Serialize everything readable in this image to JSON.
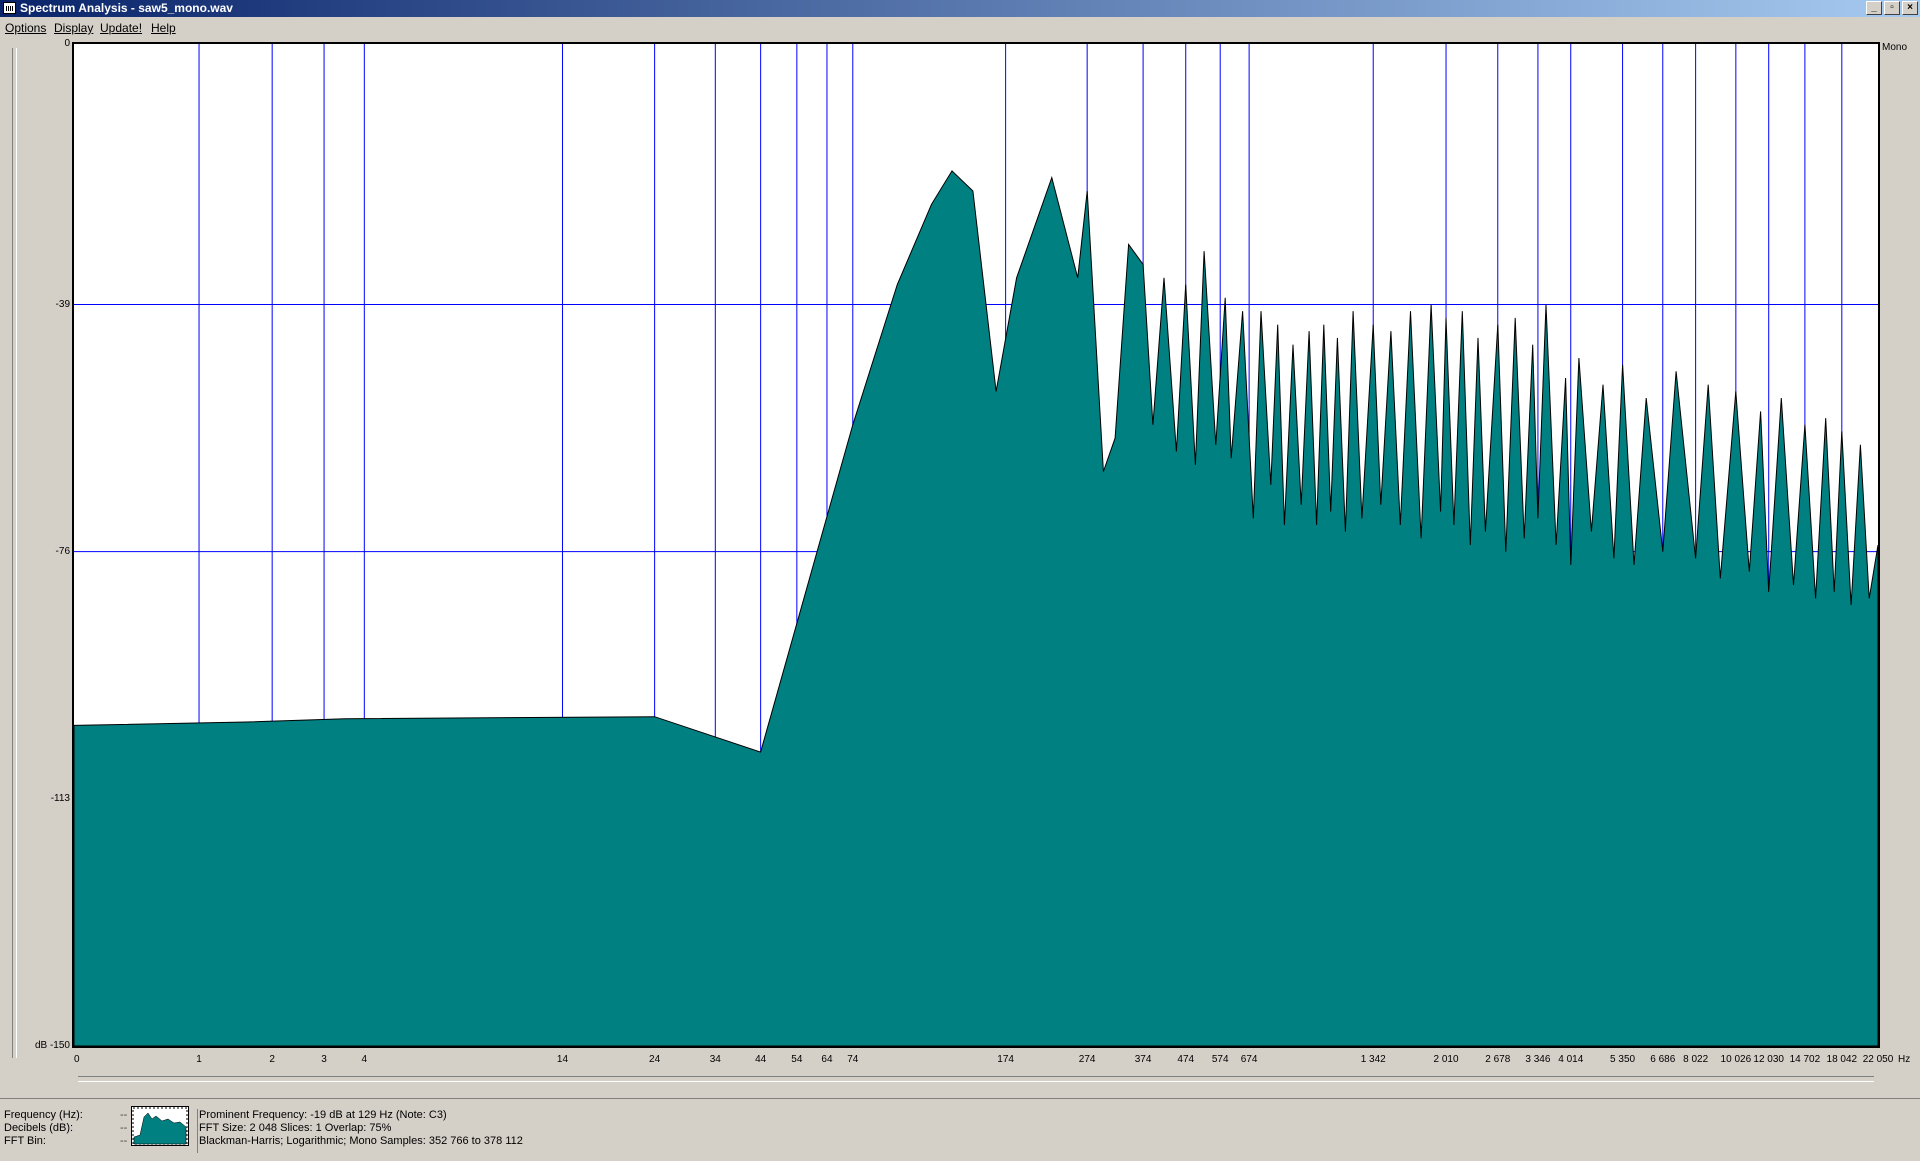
{
  "window": {
    "title": "Spectrum Analysis - saw5_mono.wav",
    "min": "_",
    "restore": "▫",
    "close": "×"
  },
  "menu": [
    "Options",
    "Display",
    "Update!",
    "Help"
  ],
  "channel": "Mono",
  "colors": {
    "fill": "#008080",
    "grid": "#0000ff",
    "outline": "#000000"
  },
  "chart_data": {
    "type": "area",
    "scale": "log-x",
    "xlabel": "Hz",
    "ylabel": "dB",
    "ylim": [
      -150,
      0
    ],
    "xlim": [
      0,
      22050
    ],
    "y_ticks": [
      {
        "label": "0",
        "value": 0
      },
      {
        "label": "-39",
        "value": -39
      },
      {
        "label": "-76",
        "value": -76
      },
      {
        "label": "-113",
        "value": -113
      },
      {
        "label": "dB -150",
        "value": -150
      }
    ],
    "x_ticks": [
      {
        "label": "0",
        "value": 0
      },
      {
        "label": "1",
        "value": 1
      },
      {
        "label": "2",
        "value": 2
      },
      {
        "label": "3",
        "value": 3
      },
      {
        "label": "4",
        "value": 4
      },
      {
        "label": "14",
        "value": 14
      },
      {
        "label": "24",
        "value": 24
      },
      {
        "label": "34",
        "value": 34
      },
      {
        "label": "44",
        "value": 44
      },
      {
        "label": "54",
        "value": 54
      },
      {
        "label": "64",
        "value": 64
      },
      {
        "label": "74",
        "value": 74
      },
      {
        "label": "174",
        "value": 174
      },
      {
        "label": "274",
        "value": 274
      },
      {
        "label": "374",
        "value": 374
      },
      {
        "label": "474",
        "value": 474
      },
      {
        "label": "574",
        "value": 574
      },
      {
        "label": "674",
        "value": 674
      },
      {
        "label": "1 342",
        "value": 1342
      },
      {
        "label": "2 010",
        "value": 2010
      },
      {
        "label": "2 678",
        "value": 2678
      },
      {
        "label": "3 346",
        "value": 3346
      },
      {
        "label": "4 014",
        "value": 4014
      },
      {
        "label": "5 350",
        "value": 5350
      },
      {
        "label": "6 686",
        "value": 6686
      },
      {
        "label": "8 022",
        "value": 8022
      },
      {
        "label": "10 026",
        "value": 10026
      },
      {
        "label": "12 030",
        "value": 12030
      },
      {
        "label": "14 702",
        "value": 14702
      },
      {
        "label": "18 042",
        "value": 18042
      },
      {
        "label": "22 050",
        "value": 22050
      }
    ],
    "x": [
      0,
      1.6,
      3.5,
      24,
      44,
      74,
      95,
      115,
      129,
      145,
      165,
      185,
      225,
      260,
      274,
      300,
      320,
      345,
      374,
      395,
      420,
      450,
      474,
      500,
      525,
      560,
      590,
      610,
      650,
      690,
      720,
      760,
      790,
      820,
      860,
      900,
      940,
      980,
      1020,
      1060,
      1100,
      1150,
      1200,
      1260,
      1342,
      1400,
      1480,
      1560,
      1650,
      1750,
      1850,
      1950,
      2010,
      2100,
      2200,
      2300,
      2400,
      2500,
      2678,
      2800,
      2950,
      3100,
      3250,
      3346,
      3500,
      3700,
      3900,
      4014,
      4200,
      4500,
      4800,
      5100,
      5350,
      5700,
      6100,
      6686,
      7200,
      8022,
      8600,
      9200,
      10026,
      10800,
      11500,
      12030,
      12900,
      13800,
      14702,
      15600,
      16500,
      17300,
      18042,
      19000,
      20000,
      21000,
      22050
    ],
    "y": [
      -102,
      -101.5,
      -101,
      -100.7,
      -106,
      -57,
      -36,
      -24,
      -19,
      -22,
      -52,
      -35,
      -20,
      -35,
      -22,
      -64,
      -59,
      -30,
      -33,
      -57,
      -35,
      -61,
      -36,
      -63,
      -31,
      -60,
      -38,
      -62,
      -40,
      -71,
      -40,
      -66,
      -42,
      -72,
      -45,
      -69,
      -43,
      -72,
      -42,
      -70,
      -44,
      -73,
      -40,
      -71,
      -42,
      -69,
      -43,
      -72,
      -40,
      -74,
      -39,
      -70,
      -41,
      -72,
      -40,
      -75,
      -44,
      -73,
      -42,
      -76,
      -41,
      -74,
      -45,
      -71,
      -39,
      -75,
      -50,
      -78,
      -47,
      -73,
      -51,
      -77,
      -48,
      -78,
      -53,
      -76,
      -49,
      -77,
      -51,
      -80,
      -52,
      -79,
      -55,
      -82,
      -53,
      -81,
      -57,
      -83,
      -56,
      -82,
      -58,
      -84,
      -60,
      -83,
      -75
    ]
  },
  "status": {
    "labels": [
      "Frequency (Hz):",
      "Decibels (dB):",
      "FFT Bin:"
    ],
    "dash": "--",
    "line1": "Prominent Frequency: -19 dB at 129 Hz (Note: C3)",
    "line2": "FFT Size: 2 048  Slices: 1  Overlap: 75%",
    "line3": "Blackman-Harris; Logarithmic; Mono  Samples: 352 766 to 378 112"
  }
}
